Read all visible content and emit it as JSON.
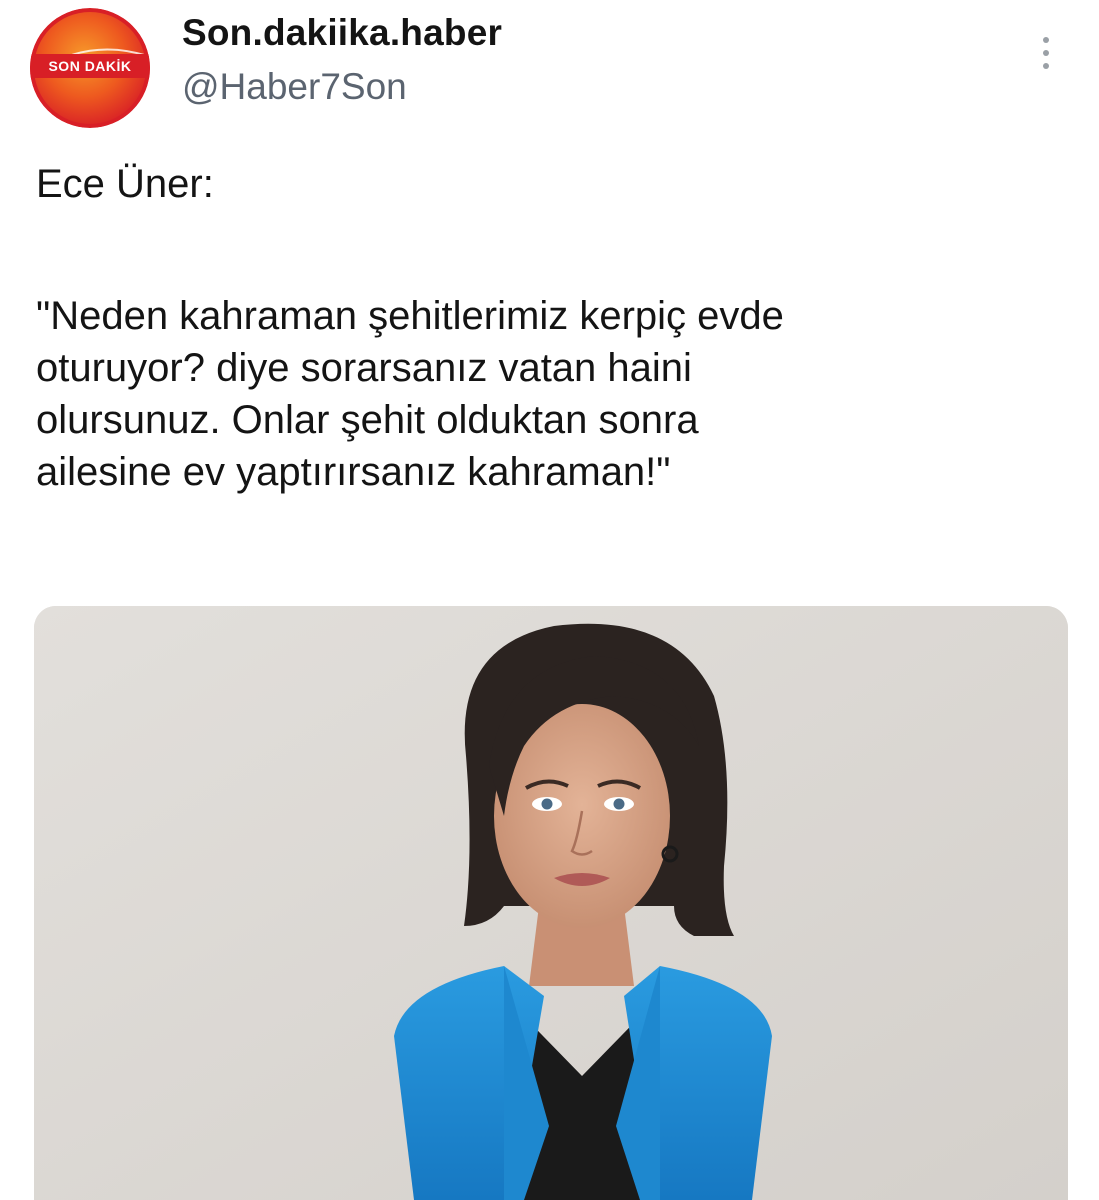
{
  "tweet": {
    "display_name": "Son.dakiika.haber",
    "handle": "@Haber7Son",
    "avatar": {
      "icon": "son-dakika-logo",
      "logo_text": "SON DAKİK",
      "colors": {
        "outer": "#d81f26",
        "inner": "#f07a1e",
        "ring": "#ffffff"
      }
    },
    "more_icon": "more-vertical-icon",
    "text": {
      "speaker": "Ece Üner:",
      "quote_lines": [
        "\"Neden kahraman şehitlerimiz kerpiç evde",
        "oturuyor? diye sorarsanız vatan haini",
        "olursunuz. Onlar şehit olduktan sonra",
        "ailesine ev yaptırırsanız kahraman!\""
      ]
    },
    "media": {
      "type": "photo",
      "colors": {
        "background": "#dcd8d3",
        "jacket": "#1f8fd6",
        "hair": "#2b2320",
        "skin": "#d9a98c"
      }
    }
  }
}
